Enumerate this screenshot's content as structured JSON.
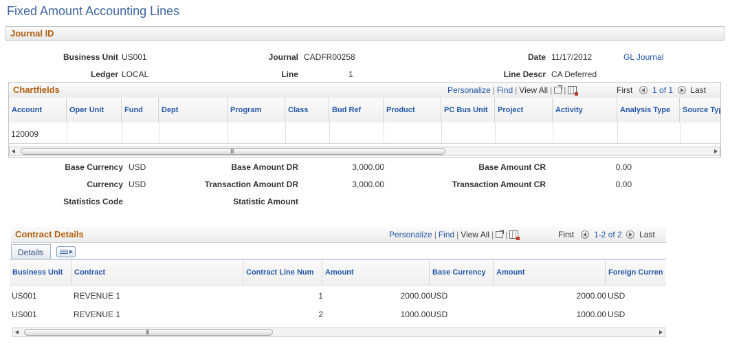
{
  "page": {
    "title": "Fixed Amount Accounting Lines"
  },
  "journal_section": {
    "title": "Journal ID",
    "business_unit_label": "Business Unit",
    "business_unit": "US001",
    "journal_label": "Journal",
    "journal": "CADFR00258",
    "date_label": "Date",
    "date": "11/17/2012",
    "gl_journal_link": "GL Journal",
    "ledger_label": "Ledger",
    "ledger": "LOCAL",
    "line_label": "Line",
    "line": "1",
    "line_descr_label": "Line Descr",
    "line_descr": "CA Deferred"
  },
  "chartfields": {
    "title": "Chartfields",
    "personalize": "Personalize",
    "find": "Find",
    "view_all": "View All",
    "first": "First",
    "range": "1 of 1",
    "last": "Last",
    "columns": [
      "Account",
      "Oper Unit",
      "Fund",
      "Dept",
      "Program",
      "Class",
      "Bud Ref",
      "Product",
      "PC Bus Unit",
      "Project",
      "Activity",
      "Analysis Type",
      "Source Typ"
    ],
    "rows": [
      [
        "120009",
        "",
        "",
        "",
        "",
        "",
        "",
        "",
        "",
        "",
        "",
        "",
        ""
      ]
    ]
  },
  "amounts": {
    "base_currency_label": "Base Currency",
    "base_currency": "USD",
    "base_amount_dr_label": "Base Amount DR",
    "base_amount_dr": "3,000.00",
    "base_amount_cr_label": "Base Amount CR",
    "base_amount_cr": "0.00",
    "currency_label": "Currency",
    "currency": "USD",
    "transaction_amount_dr_label": "Transaction Amount DR",
    "transaction_amount_dr": "3,000.00",
    "transaction_amount_cr_label": "Transaction Amount CR",
    "transaction_amount_cr": "0.00",
    "statistics_code_label": "Statistics Code",
    "statistic_amount_label": "Statistic Amount"
  },
  "contract_details": {
    "title": "Contract Details",
    "personalize": "Personalize",
    "find": "Find",
    "view_all": "View All",
    "first": "First",
    "range": "1-2 of 2",
    "last": "Last",
    "tab_label": "Details",
    "columns": [
      "Business Unit",
      "Contract",
      "Contract Line Num",
      "Amount",
      "Base Currency",
      "Amount",
      "Foreign Curren"
    ],
    "rows": [
      [
        "US001",
        "REVENUE 1",
        "1",
        "2000.00",
        "USD",
        "2000.00",
        "USD"
      ],
      [
        "US001",
        "REVENUE 1",
        "2",
        "1000.00",
        "USD",
        "1000.00",
        "USD"
      ]
    ]
  },
  "colors": {
    "title": "#3e66a1",
    "section_title": "#b45f10",
    "link": "#2356a5"
  }
}
